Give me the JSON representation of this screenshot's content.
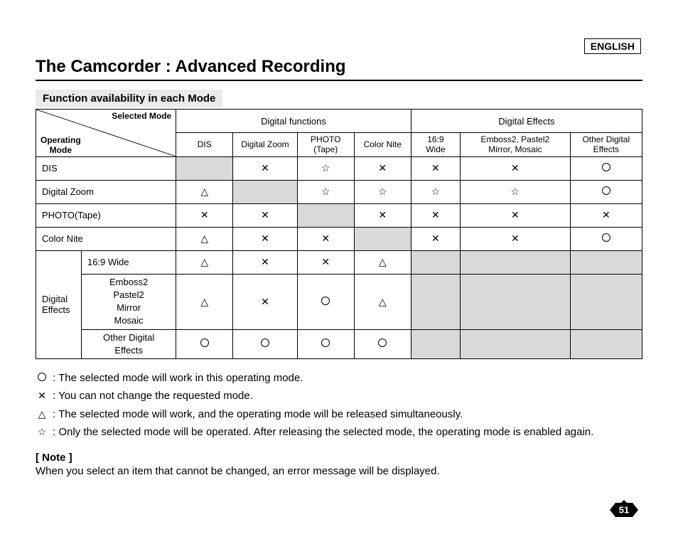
{
  "lang": "ENGLISH",
  "title": "The Camcorder : Advanced Recording",
  "subhead": "Function availability in each Mode",
  "diag": {
    "top": "Selected Mode",
    "bottom": "Operating\nMode"
  },
  "header_groups": {
    "dfunc": "Digital functions",
    "deff": "Digital Effects"
  },
  "cols": {
    "dis": "DIS",
    "dzoom": "Digital Zoom",
    "photo": "PHOTO\n(Tape)",
    "cnite": "Color Nite",
    "wide": "16:9\nWide",
    "emb": "Emboss2, Pastel2\nMirror, Mosaic",
    "other": "Other Digital\nEffects"
  },
  "rows": {
    "dis": "DIS",
    "dzoom": "Digital Zoom",
    "photo": "PHOTO(Tape)",
    "cnite": "Color Nite",
    "deff_group": "Digital\nEffects",
    "wide": "16:9 Wide",
    "emb": "Emboss2\nPastel2\nMirror\nMosaic",
    "other": "Other Digital\nEffects"
  },
  "legend": {
    "circle": ": The selected mode will work in this operating mode.",
    "cross": ": You can not change the requested mode.",
    "triangle": ": The selected mode will work, and the operating mode will be released simultaneously.",
    "star": ": Only the selected mode will be operated. After releasing the selected mode, the operating mode is enabled again."
  },
  "note_head": "[ Note ]",
  "note_body": "When you select an item that cannot be changed, an error message will be displayed.",
  "page_num": "51",
  "chart_data": {
    "type": "table",
    "title": "Function availability in each Mode",
    "columns": [
      "DIS",
      "Digital Zoom",
      "PHOTO (Tape)",
      "Color Nite",
      "16:9 Wide",
      "Emboss2, Pastel2 Mirror, Mosaic",
      "Other Digital Effects"
    ],
    "rows": [
      {
        "operating_mode": "DIS",
        "values": [
          "—",
          "✕",
          "☆",
          "✕",
          "✕",
          "✕",
          "O"
        ]
      },
      {
        "operating_mode": "Digital Zoom",
        "values": [
          "△",
          "—",
          "☆",
          "☆",
          "☆",
          "☆",
          "O"
        ]
      },
      {
        "operating_mode": "PHOTO(Tape)",
        "values": [
          "✕",
          "✕",
          "—",
          "✕",
          "✕",
          "✕",
          "✕"
        ]
      },
      {
        "operating_mode": "Color Nite",
        "values": [
          "△",
          "✕",
          "✕",
          "—",
          "✕",
          "✕",
          "O"
        ]
      },
      {
        "operating_mode": "Digital Effects / 16:9 Wide",
        "values": [
          "△",
          "✕",
          "✕",
          "△",
          "—",
          "—",
          "—"
        ]
      },
      {
        "operating_mode": "Digital Effects / Emboss2 Pastel2 Mirror Mosaic",
        "values": [
          "△",
          "✕",
          "O",
          "△",
          "—",
          "—",
          "—"
        ]
      },
      {
        "operating_mode": "Digital Effects / Other Digital Effects",
        "values": [
          "O",
          "O",
          "O",
          "O",
          "—",
          "—",
          "—"
        ]
      }
    ],
    "legend": {
      "O": "The selected mode will work in this operating mode.",
      "✕": "You can not change the requested mode.",
      "△": "The selected mode will work, and the operating mode will be released simultaneously.",
      "☆": "Only the selected mode will be operated. After releasing the selected mode, the operating mode is enabled again.",
      "—": "same-mode intersection (greyed cell)"
    }
  }
}
